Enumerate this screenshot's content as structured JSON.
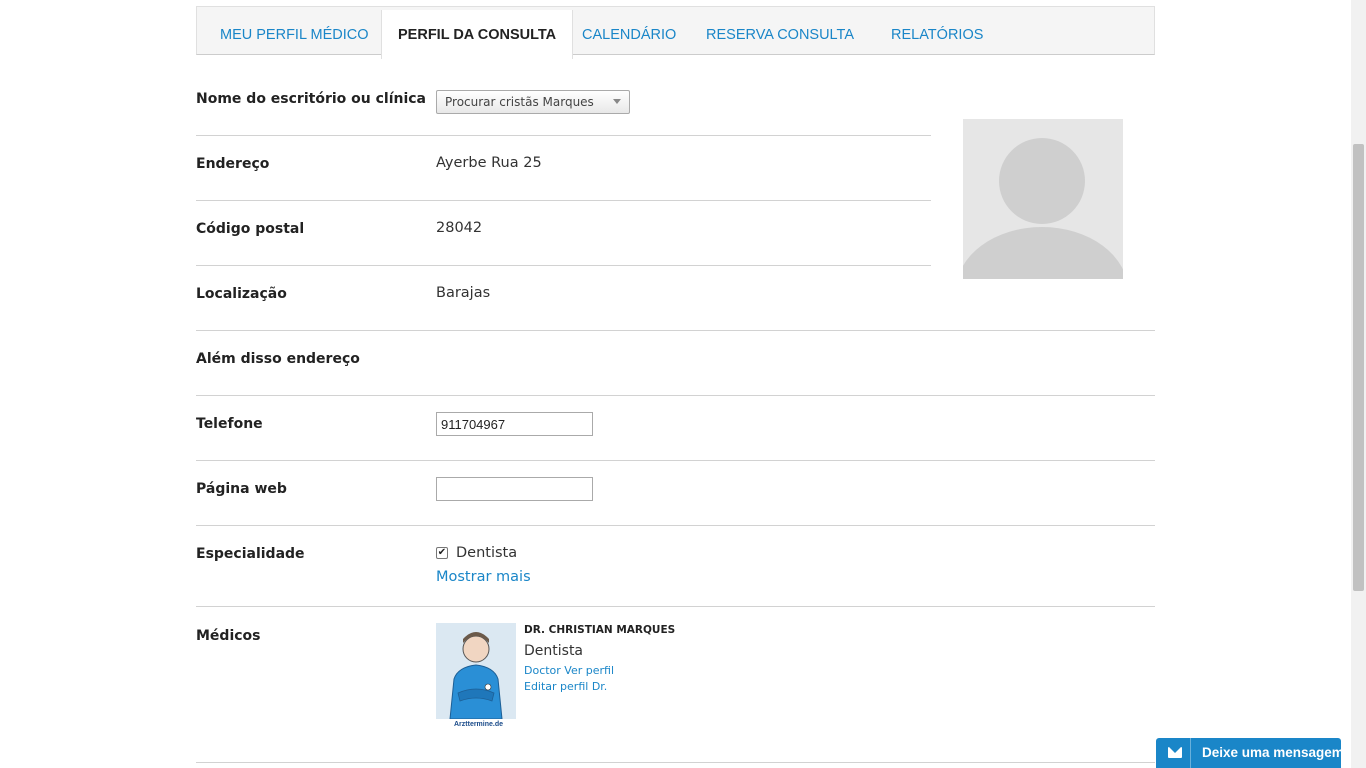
{
  "tabs": [
    {
      "label": "MEU PERFIL MÉDICO"
    },
    {
      "label": "PERFIL DA CONSULTA"
    },
    {
      "label": "CALENDÁRIO"
    },
    {
      "label": "RESERVA CONSULTA"
    },
    {
      "label": "RELATÓRIOS"
    }
  ],
  "active_tab": "PERFIL DA CONSULTA",
  "form": {
    "clinic_label": "Nome do escritório ou clínica",
    "clinic_select": "Procurar cristãs Marques",
    "address_label": "Endereço",
    "address_value": "Ayerbe Rua 25",
    "postal_label": "Código postal",
    "postal_value": "28042",
    "location_label": "Localização",
    "location_value": "Barajas",
    "extra_address_label": "Além disso endereço",
    "phone_label": "Telefone",
    "phone_value": "911704967",
    "website_label": "Página web",
    "website_value": "",
    "specialty_label": "Especialidade",
    "specialty_option": "Dentista",
    "specialty_checked": true,
    "show_more": "Mostrar mais",
    "doctors_label": "Médicos"
  },
  "doctor": {
    "name": "DR. CHRISTIAN MARQUES",
    "specialty": "Dentista",
    "view_profile": "Doctor Ver perfil",
    "edit_profile": "Editar perfil Dr.",
    "brand": "Arzttermine.de"
  },
  "chat": {
    "label": "Deixe uma mensagem"
  },
  "colors": {
    "link": "#1a86c8",
    "chat_bg": "#1a86c8"
  }
}
